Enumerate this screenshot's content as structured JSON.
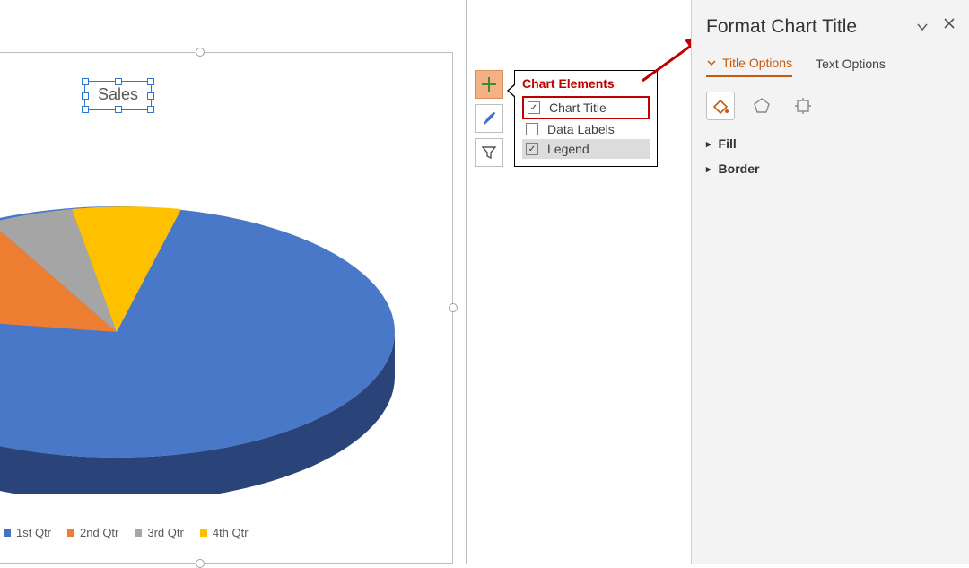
{
  "chart_data": {
    "type": "pie",
    "title": "Sales",
    "series_name": "Sales",
    "categories": [
      "1st Qtr",
      "2nd Qtr",
      "3rd Qtr",
      "4th Qtr"
    ],
    "values": [
      58,
      23,
      10,
      9
    ],
    "colors": {
      "1st Qtr": "#4472c4",
      "2nd Qtr": "#ed7d31",
      "3rd Qtr": "#a5a5a5",
      "4th Qtr": "#ffc000"
    },
    "legend_position": "bottom",
    "style": "3d"
  },
  "chart_elements": {
    "popup_title": "Chart Elements",
    "items": [
      {
        "label": "Chart Title",
        "checked": true,
        "highlight": true
      },
      {
        "label": "Data Labels",
        "checked": false,
        "highlight": false
      },
      {
        "label": "Legend",
        "checked": true,
        "highlight": false,
        "hover": true
      }
    ]
  },
  "float_buttons": {
    "plus_title": "Chart Elements",
    "brush_title": "Chart Styles",
    "funnel_title": "Chart Filters"
  },
  "format_pane": {
    "title": "Format Chart Title",
    "tabs": {
      "title_options": "Title Options",
      "text_options": "Text Options"
    },
    "active_tab": "title_options",
    "categories": {
      "fill_line": "Fill & Line",
      "effects": "Effects",
      "size": "Size & Properties"
    },
    "active_category": "fill_line",
    "sections": {
      "fill": "Fill",
      "border": "Border"
    }
  }
}
